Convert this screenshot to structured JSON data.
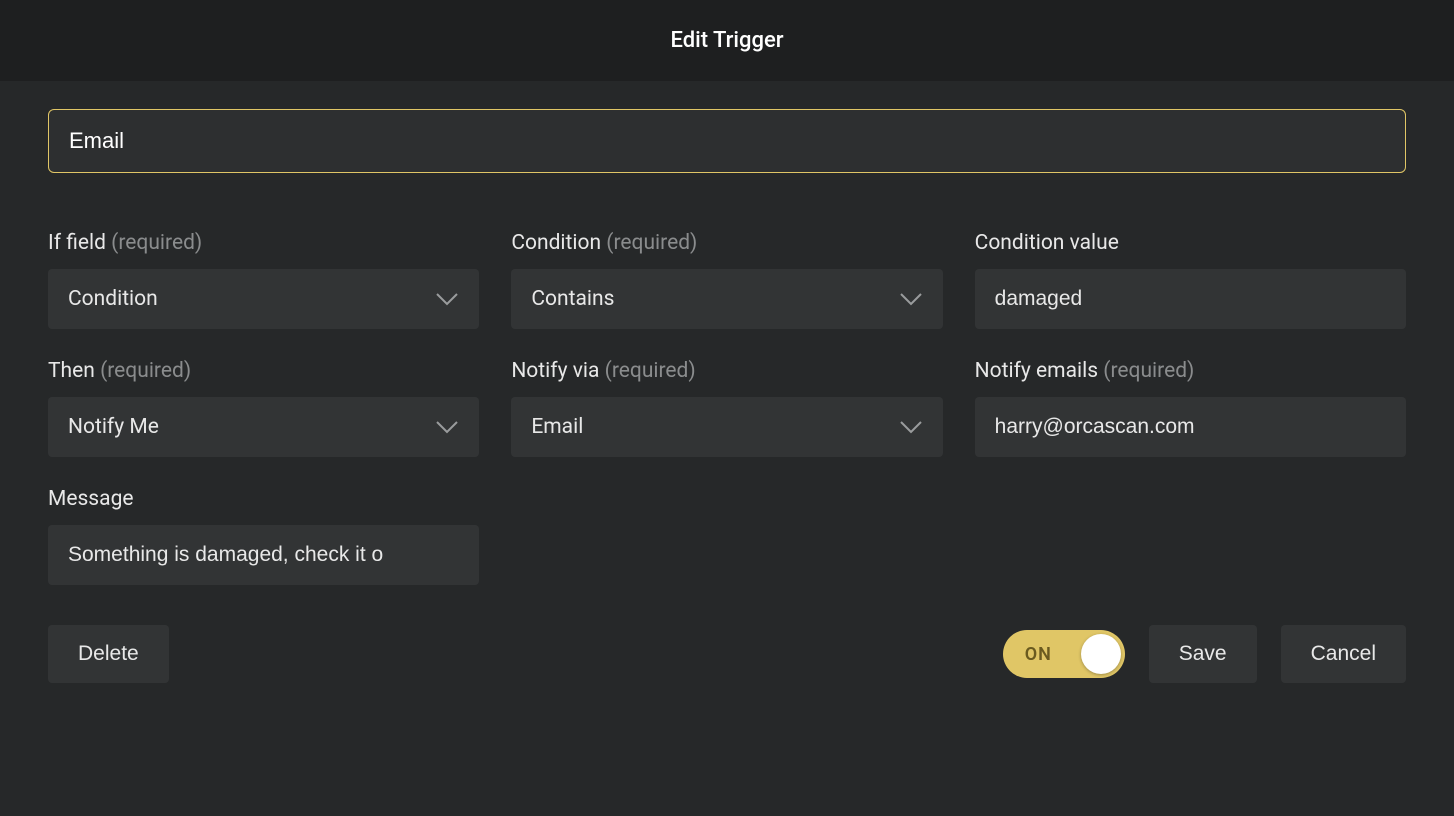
{
  "modal": {
    "title": "Edit Trigger",
    "name_value": "Email"
  },
  "fields": {
    "if_field": {
      "label": "If field",
      "required": "(required)",
      "value": "Condition"
    },
    "condition": {
      "label": "Condition",
      "required": "(required)",
      "value": "Contains"
    },
    "condition_value": {
      "label": "Condition value",
      "value": "damaged"
    },
    "then": {
      "label": "Then",
      "required": "(required)",
      "value": "Notify Me"
    },
    "notify_via": {
      "label": "Notify via",
      "required": "(required)",
      "value": "Email"
    },
    "notify_emails": {
      "label": "Notify emails",
      "required": "(required)",
      "value": "harry@orcascan.com"
    },
    "message": {
      "label": "Message",
      "value": "Something is damaged, check it o"
    }
  },
  "footer": {
    "delete": "Delete",
    "toggle": "ON",
    "save": "Save",
    "cancel": "Cancel"
  }
}
